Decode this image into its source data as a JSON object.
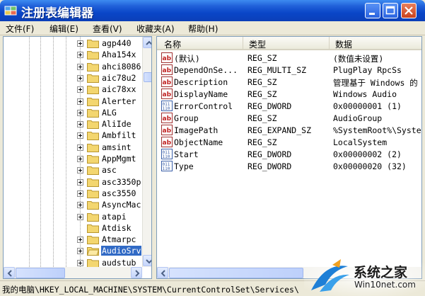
{
  "window": {
    "title": "注册表编辑器"
  },
  "menu": [
    {
      "label": "文件(F)"
    },
    {
      "label": "编辑(E)"
    },
    {
      "label": "查看(V)"
    },
    {
      "label": "收藏夹(A)"
    },
    {
      "label": "帮助(H)"
    }
  ],
  "tree": {
    "items": [
      {
        "label": "agp440",
        "expandable": true
      },
      {
        "label": "Aha154x",
        "expandable": true
      },
      {
        "label": "ahci8086",
        "expandable": true
      },
      {
        "label": "aic78u2",
        "expandable": true
      },
      {
        "label": "aic78xx",
        "expandable": true
      },
      {
        "label": "Alerter",
        "expandable": true
      },
      {
        "label": "ALG",
        "expandable": true
      },
      {
        "label": "AliIde",
        "expandable": true
      },
      {
        "label": "Ambfilt",
        "expandable": true
      },
      {
        "label": "amsint",
        "expandable": true
      },
      {
        "label": "AppMgmt",
        "expandable": true
      },
      {
        "label": "asc",
        "expandable": true
      },
      {
        "label": "asc3350p",
        "expandable": true
      },
      {
        "label": "asc3550",
        "expandable": true
      },
      {
        "label": "AsyncMac",
        "expandable": true
      },
      {
        "label": "atapi",
        "expandable": true
      },
      {
        "label": "Atdisk",
        "expandable": false
      },
      {
        "label": "Atmarpc",
        "expandable": true
      },
      {
        "label": "AudioSrv",
        "expandable": true,
        "selected": true
      },
      {
        "label": "audstub",
        "expandable": true
      }
    ]
  },
  "list": {
    "columns": {
      "name": "名称",
      "type": "类型",
      "data": "数据"
    },
    "rows": [
      {
        "icon": "string-value-icon",
        "name": "(默认)",
        "type": "REG_SZ",
        "data": "(数值未设置)"
      },
      {
        "icon": "string-value-icon",
        "name": "DependOnSe...",
        "type": "REG_MULTI_SZ",
        "data": "PlugPlay RpcSs"
      },
      {
        "icon": "string-value-icon",
        "name": "Description",
        "type": "REG_SZ",
        "data": "管理基于 Windows 的"
      },
      {
        "icon": "string-value-icon",
        "name": "DisplayName",
        "type": "REG_SZ",
        "data": "Windows Audio"
      },
      {
        "icon": "binary-value-icon",
        "name": "ErrorControl",
        "type": "REG_DWORD",
        "data": "0x00000001 (1)"
      },
      {
        "icon": "string-value-icon",
        "name": "Group",
        "type": "REG_SZ",
        "data": "AudioGroup"
      },
      {
        "icon": "string-value-icon",
        "name": "ImagePath",
        "type": "REG_EXPAND_SZ",
        "data": "%SystemRoot%\\Syste"
      },
      {
        "icon": "string-value-icon",
        "name": "ObjectName",
        "type": "REG_SZ",
        "data": "LocalSystem"
      },
      {
        "icon": "binary-value-icon",
        "name": "Start",
        "type": "REG_DWORD",
        "data": "0x00000002 (2)"
      },
      {
        "icon": "binary-value-icon",
        "name": "Type",
        "type": "REG_DWORD",
        "data": "0x00000020 (32)"
      }
    ]
  },
  "status": {
    "path": "我的电脑\\HKEY_LOCAL_MACHINE\\SYSTEM\\CurrentControlSet\\Services\\"
  },
  "watermark": {
    "brand": "系统之家",
    "site": "Win10net.com"
  },
  "colors": {
    "titlebar": "#0a46c8",
    "selection": "#316ac5",
    "close": "#c9421e"
  }
}
